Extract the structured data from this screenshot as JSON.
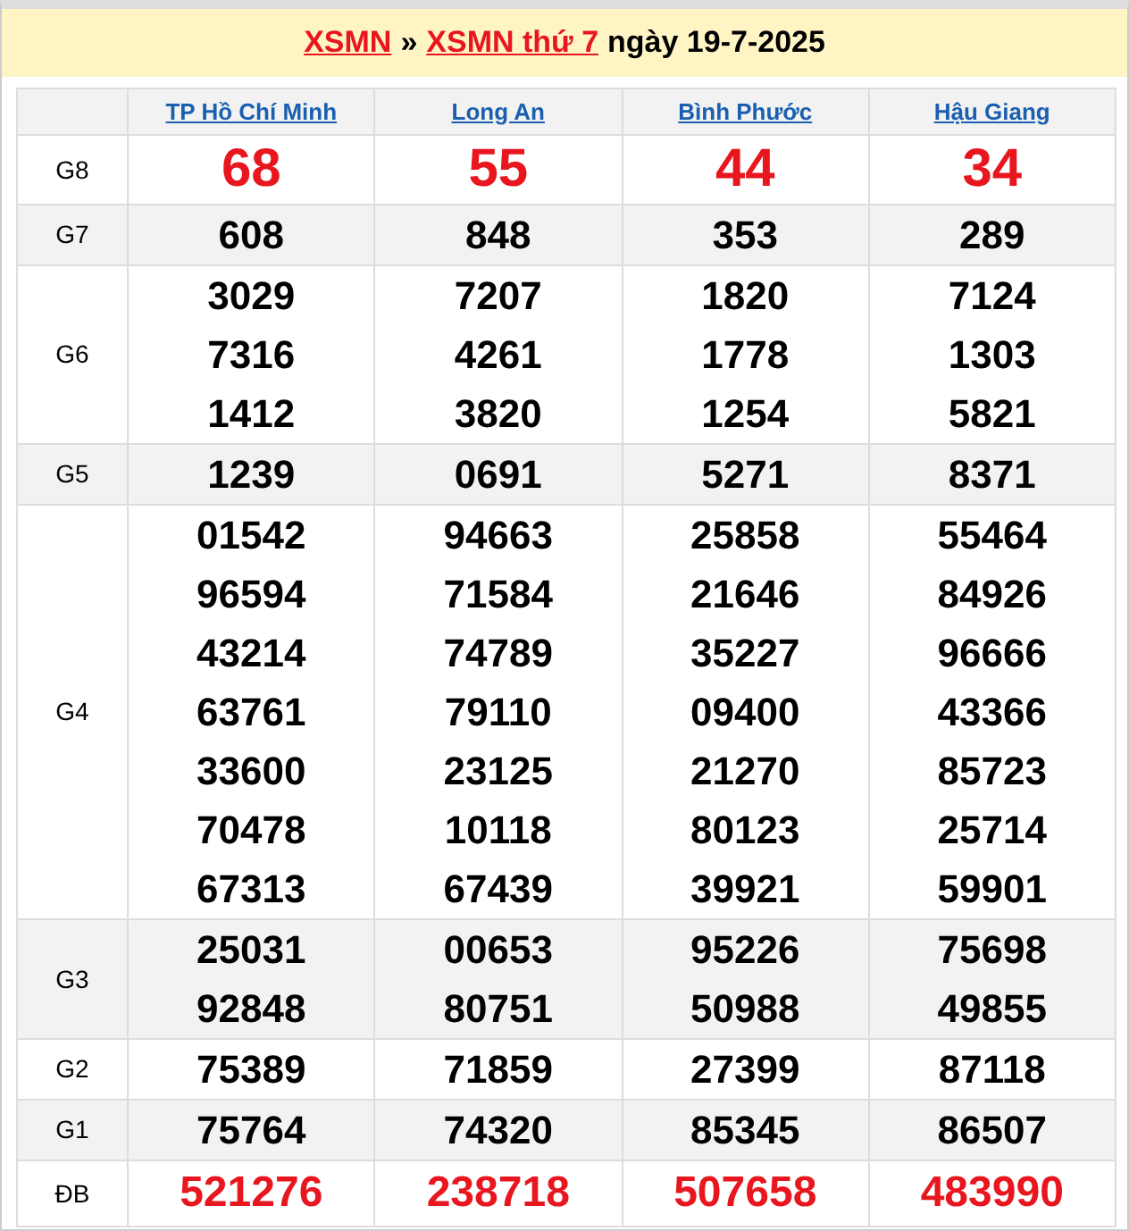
{
  "title": {
    "link_1": "XSMN",
    "separator": "»",
    "link_2": "XSMN thứ 7",
    "date": "ngày 19-7-2025"
  },
  "provinces": [
    "TP Hồ Chí Minh",
    "Long An",
    "Bình Phước",
    "Hậu Giang"
  ],
  "prizes": [
    {
      "label": "G8",
      "kind": "special",
      "results": [
        [
          "68"
        ],
        [
          "55"
        ],
        [
          "44"
        ],
        [
          "34"
        ]
      ]
    },
    {
      "label": "G7",
      "kind": "normal",
      "results": [
        [
          "608"
        ],
        [
          "848"
        ],
        [
          "353"
        ],
        [
          "289"
        ]
      ]
    },
    {
      "label": "G6",
      "kind": "normal",
      "results": [
        [
          "3029",
          "7316",
          "1412"
        ],
        [
          "7207",
          "4261",
          "3820"
        ],
        [
          "1820",
          "1778",
          "1254"
        ],
        [
          "7124",
          "1303",
          "5821"
        ]
      ]
    },
    {
      "label": "G5",
      "kind": "normal",
      "results": [
        [
          "1239"
        ],
        [
          "0691"
        ],
        [
          "5271"
        ],
        [
          "8371"
        ]
      ]
    },
    {
      "label": "G4",
      "kind": "normal",
      "results": [
        [
          "01542",
          "96594",
          "43214",
          "63761",
          "33600",
          "70478",
          "67313"
        ],
        [
          "94663",
          "71584",
          "74789",
          "79110",
          "23125",
          "10118",
          "67439"
        ],
        [
          "25858",
          "21646",
          "35227",
          "09400",
          "21270",
          "80123",
          "39921"
        ],
        [
          "55464",
          "84926",
          "96666",
          "43366",
          "85723",
          "25714",
          "59901"
        ]
      ]
    },
    {
      "label": "G3",
      "kind": "normal",
      "results": [
        [
          "25031",
          "92848"
        ],
        [
          "00653",
          "80751"
        ],
        [
          "95226",
          "50988"
        ],
        [
          "75698",
          "49855"
        ]
      ]
    },
    {
      "label": "G2",
      "kind": "normal",
      "results": [
        [
          "75389"
        ],
        [
          "71859"
        ],
        [
          "27399"
        ],
        [
          "87118"
        ]
      ]
    },
    {
      "label": "G1",
      "kind": "normal",
      "results": [
        [
          "75764"
        ],
        [
          "74320"
        ],
        [
          "85345"
        ],
        [
          "86507"
        ]
      ]
    },
    {
      "label": "ĐB",
      "kind": "jackpot",
      "results": [
        [
          "521276"
        ],
        [
          "238718"
        ],
        [
          "507658"
        ],
        [
          "483990"
        ]
      ]
    }
  ]
}
